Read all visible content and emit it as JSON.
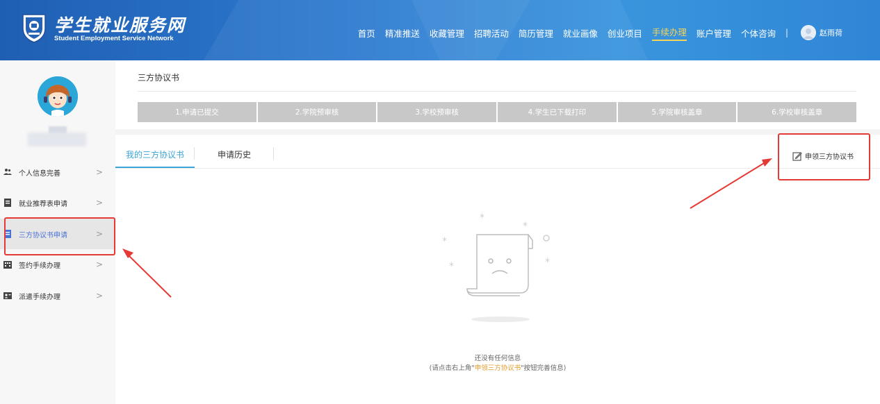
{
  "header": {
    "logo_cn": "学生就业服务网",
    "logo_en": "Student Employment Service Network",
    "nav": [
      {
        "label": "首页"
      },
      {
        "label": "精准推送"
      },
      {
        "label": "收藏管理"
      },
      {
        "label": "招聘活动"
      },
      {
        "label": "简历管理"
      },
      {
        "label": "就业画像"
      },
      {
        "label": "创业项目"
      },
      {
        "label": "手续办理",
        "active": true
      },
      {
        "label": "账户管理"
      },
      {
        "label": "个体咨询"
      }
    ],
    "separator": "|",
    "user_name": "赵雨荷"
  },
  "sidebar": {
    "items": [
      {
        "label": "个人信息完善",
        "icon": "user-group-icon"
      },
      {
        "label": "就业推荐表申请",
        "icon": "document-icon"
      },
      {
        "label": "三方协议书申请",
        "icon": "document-icon",
        "active": true
      },
      {
        "label": "签约手续办理",
        "icon": "building-icon"
      },
      {
        "label": "派遣手续办理",
        "icon": "id-card-icon"
      }
    ],
    "chevron": ">"
  },
  "main": {
    "title": "三方协议书",
    "steps": [
      "1.申请已提交",
      "2.学院预审核",
      "3.学校预审核",
      "4.学生已下载打印",
      "5.学院审核盖章",
      "6.学校审核盖章"
    ],
    "tabs": [
      {
        "label": "我的三方协议书",
        "active": true
      },
      {
        "label": "申请历史"
      }
    ],
    "apply_button": "申领三方协议书",
    "empty": {
      "line1": "还没有任何信息",
      "line2_prefix": "(请点击右上角\"",
      "line2_highlight": "申领三方协议书",
      "line2_suffix": "\"按钮完善信息)"
    }
  },
  "colors": {
    "header_blue": "#2d7ad0",
    "accent_cyan": "#3ba5d8",
    "active_nav": "#f4d35a",
    "annotation_red": "#e53935",
    "step_gray": "#c8c8c8",
    "highlight_orange": "#e59b2a"
  }
}
